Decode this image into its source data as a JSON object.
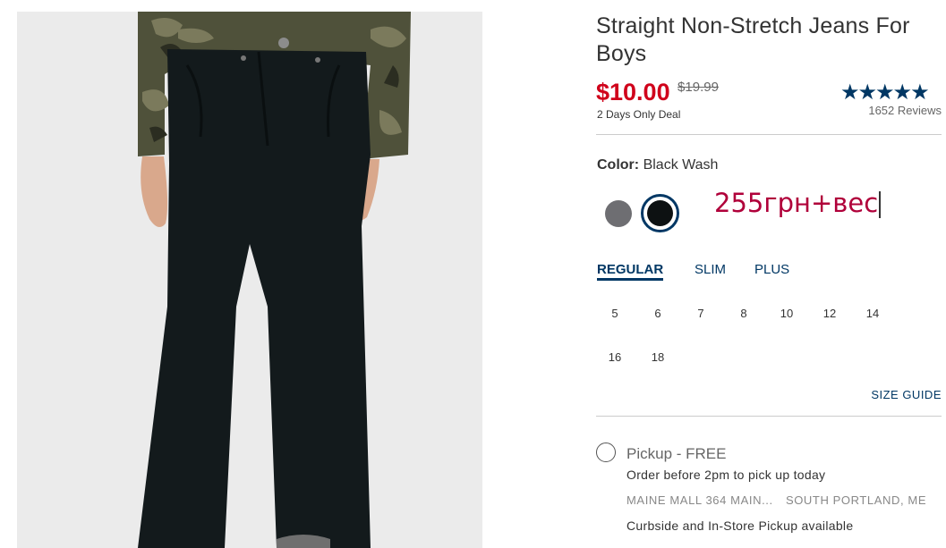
{
  "product": {
    "title": "Straight Non-Stretch Jeans For Boys",
    "price": "$10.00",
    "original_price": "$19.99",
    "deal_text": "2 Days Only Deal",
    "rating_stars": "★★★★★",
    "reviews": "1652 Reviews"
  },
  "color": {
    "label": "Color:",
    "value": "Black Wash",
    "swatches": [
      "gray",
      "black-wash"
    ],
    "selected": "black-wash"
  },
  "annotation": "255грн+вес",
  "fit_tabs": [
    {
      "label": "REGULAR",
      "active": true
    },
    {
      "label": "SLIM",
      "active": false
    },
    {
      "label": "PLUS",
      "active": false
    }
  ],
  "sizes": [
    "5",
    "6",
    "7",
    "8",
    "10",
    "12",
    "14",
    "16",
    "18"
  ],
  "size_guide": "SIZE GUIDE",
  "pickup": {
    "title": "Pickup - FREE",
    "note": "Order before 2pm to pick up today",
    "store_address": "MAINE MALL 364 MAIN...",
    "store_city": "SOUTH PORTLAND, ME",
    "curbside": "Curbside and In-Store Pickup available"
  },
  "colors": {
    "price_red": "#d0021b",
    "navy": "#003764",
    "annotation": "#b0003a"
  }
}
